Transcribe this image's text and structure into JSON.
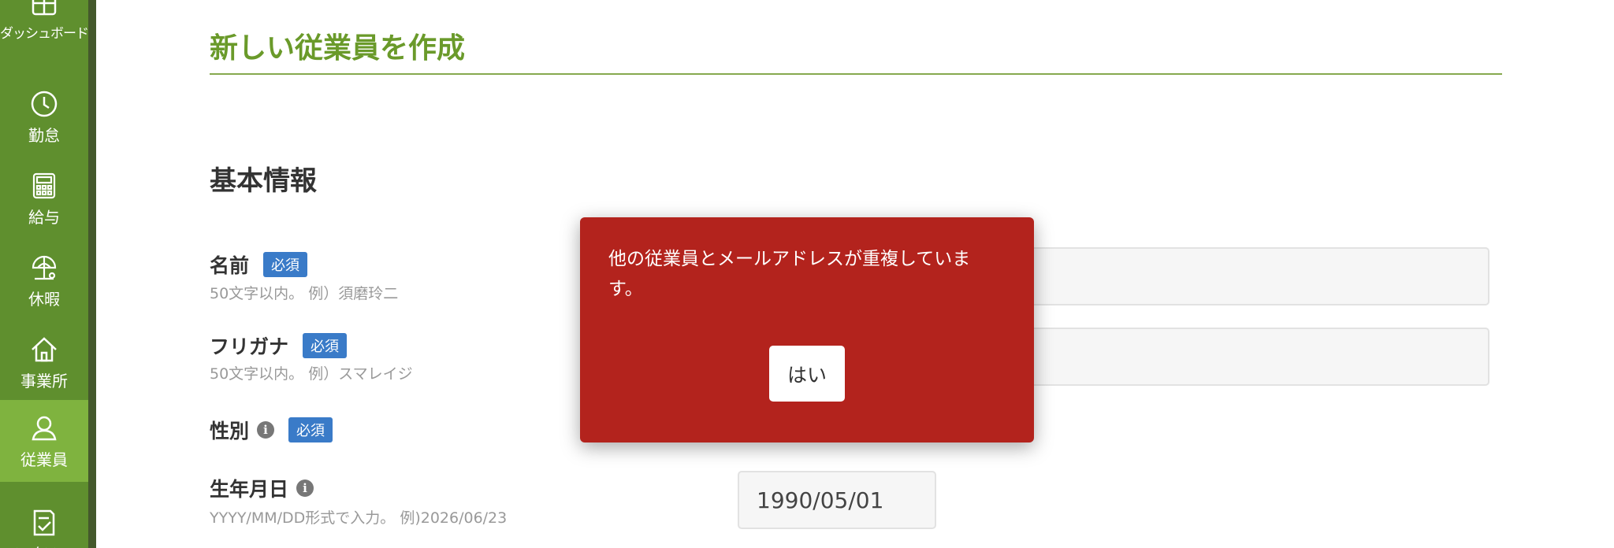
{
  "sidebar": {
    "items": [
      {
        "label": "ダッシュボード",
        "icon": "dashboard-icon"
      },
      {
        "label": "勤怠",
        "icon": "clock-icon"
      },
      {
        "label": "給与",
        "icon": "calculator-icon"
      },
      {
        "label": "休暇",
        "icon": "beach-umbrella-icon"
      },
      {
        "label": "事業所",
        "icon": "home-icon"
      },
      {
        "label": "従業員",
        "icon": "person-icon",
        "active": true
      },
      {
        "label": "ワークフロー",
        "icon": "checklist-icon"
      }
    ]
  },
  "page": {
    "title": "新しい従業員を作成",
    "section_title": "基本情報"
  },
  "form": {
    "required_badge": "必須",
    "info_icon": "i",
    "name": {
      "label": "名前",
      "hint": "50文字以内。 例）須磨玲二",
      "value": ""
    },
    "furigana": {
      "label": "フリガナ",
      "hint": "50文字以内。 例）スマレイジ",
      "value": ""
    },
    "gender": {
      "label": "性別"
    },
    "birthday": {
      "label": "生年月日",
      "hint": "YYYY/MM/DD形式で入力。 例)2026/06/23",
      "value": "1990/05/01"
    }
  },
  "dialog": {
    "message": "他の従業員とメールアドレスが重複しています。",
    "confirm_label": "はい"
  },
  "colors": {
    "sidebar": "#5f8f2e",
    "sidebar_active": "#7fb33f",
    "title_green": "#6a9a2a",
    "badge_blue": "#3a7bc8",
    "dialog_red": "#b3231d"
  }
}
